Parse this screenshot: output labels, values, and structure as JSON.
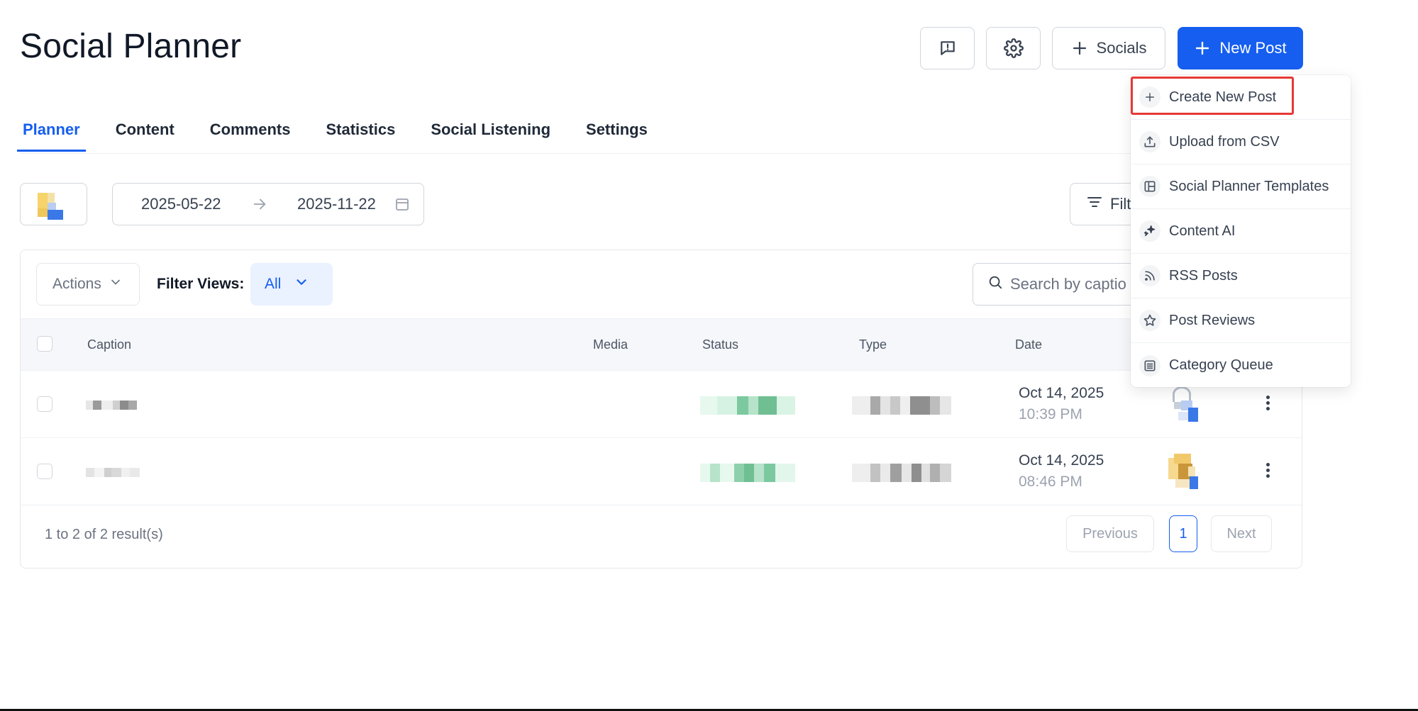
{
  "page": {
    "title": "Social Planner"
  },
  "header": {
    "feedback_icon": "message-alert-icon",
    "settings_icon": "gear-icon",
    "socials_label": "Socials",
    "new_post_label": "New Post"
  },
  "tabs": [
    {
      "label": "Planner",
      "active": true
    },
    {
      "label": "Content",
      "active": false
    },
    {
      "label": "Comments",
      "active": false
    },
    {
      "label": "Statistics",
      "active": false
    },
    {
      "label": "Social Listening",
      "active": false
    },
    {
      "label": "Settings",
      "active": false
    }
  ],
  "date_range": {
    "start": "2025-05-22",
    "end": "2025-11-22"
  },
  "filters_label": "Filt",
  "toolbar": {
    "actions_label": "Actions",
    "filter_views_label": "Filter Views:",
    "filter_views_value": "All",
    "search_placeholder": "Search by captio"
  },
  "table": {
    "columns": [
      "Caption",
      "Media",
      "Status",
      "Type",
      "Date"
    ],
    "rows": [
      {
        "date": "Oct 14, 2025",
        "time": "10:39 PM"
      },
      {
        "date": "Oct 14, 2025",
        "time": "08:46 PM"
      }
    ]
  },
  "pagination": {
    "summary": "1 to 2 of 2 result(s)",
    "previous_label": "Previous",
    "page": "1",
    "next_label": "Next"
  },
  "new_post_menu": {
    "items": [
      {
        "label": "Create New Post",
        "icon": "plus-icon",
        "highlighted": true
      },
      {
        "label": "Upload from CSV",
        "icon": "upload-icon"
      },
      {
        "label": "Social Planner Templates",
        "icon": "template-icon"
      },
      {
        "label": "Content AI",
        "icon": "sparkle-icon"
      },
      {
        "label": "RSS Posts",
        "icon": "rss-icon"
      },
      {
        "label": "Post Reviews",
        "icon": "star-icon"
      },
      {
        "label": "Category Queue",
        "icon": "list-icon"
      }
    ]
  },
  "colors": {
    "primary": "#155eef",
    "highlight_border": "#e53935",
    "status_green": "#5cc08a"
  }
}
